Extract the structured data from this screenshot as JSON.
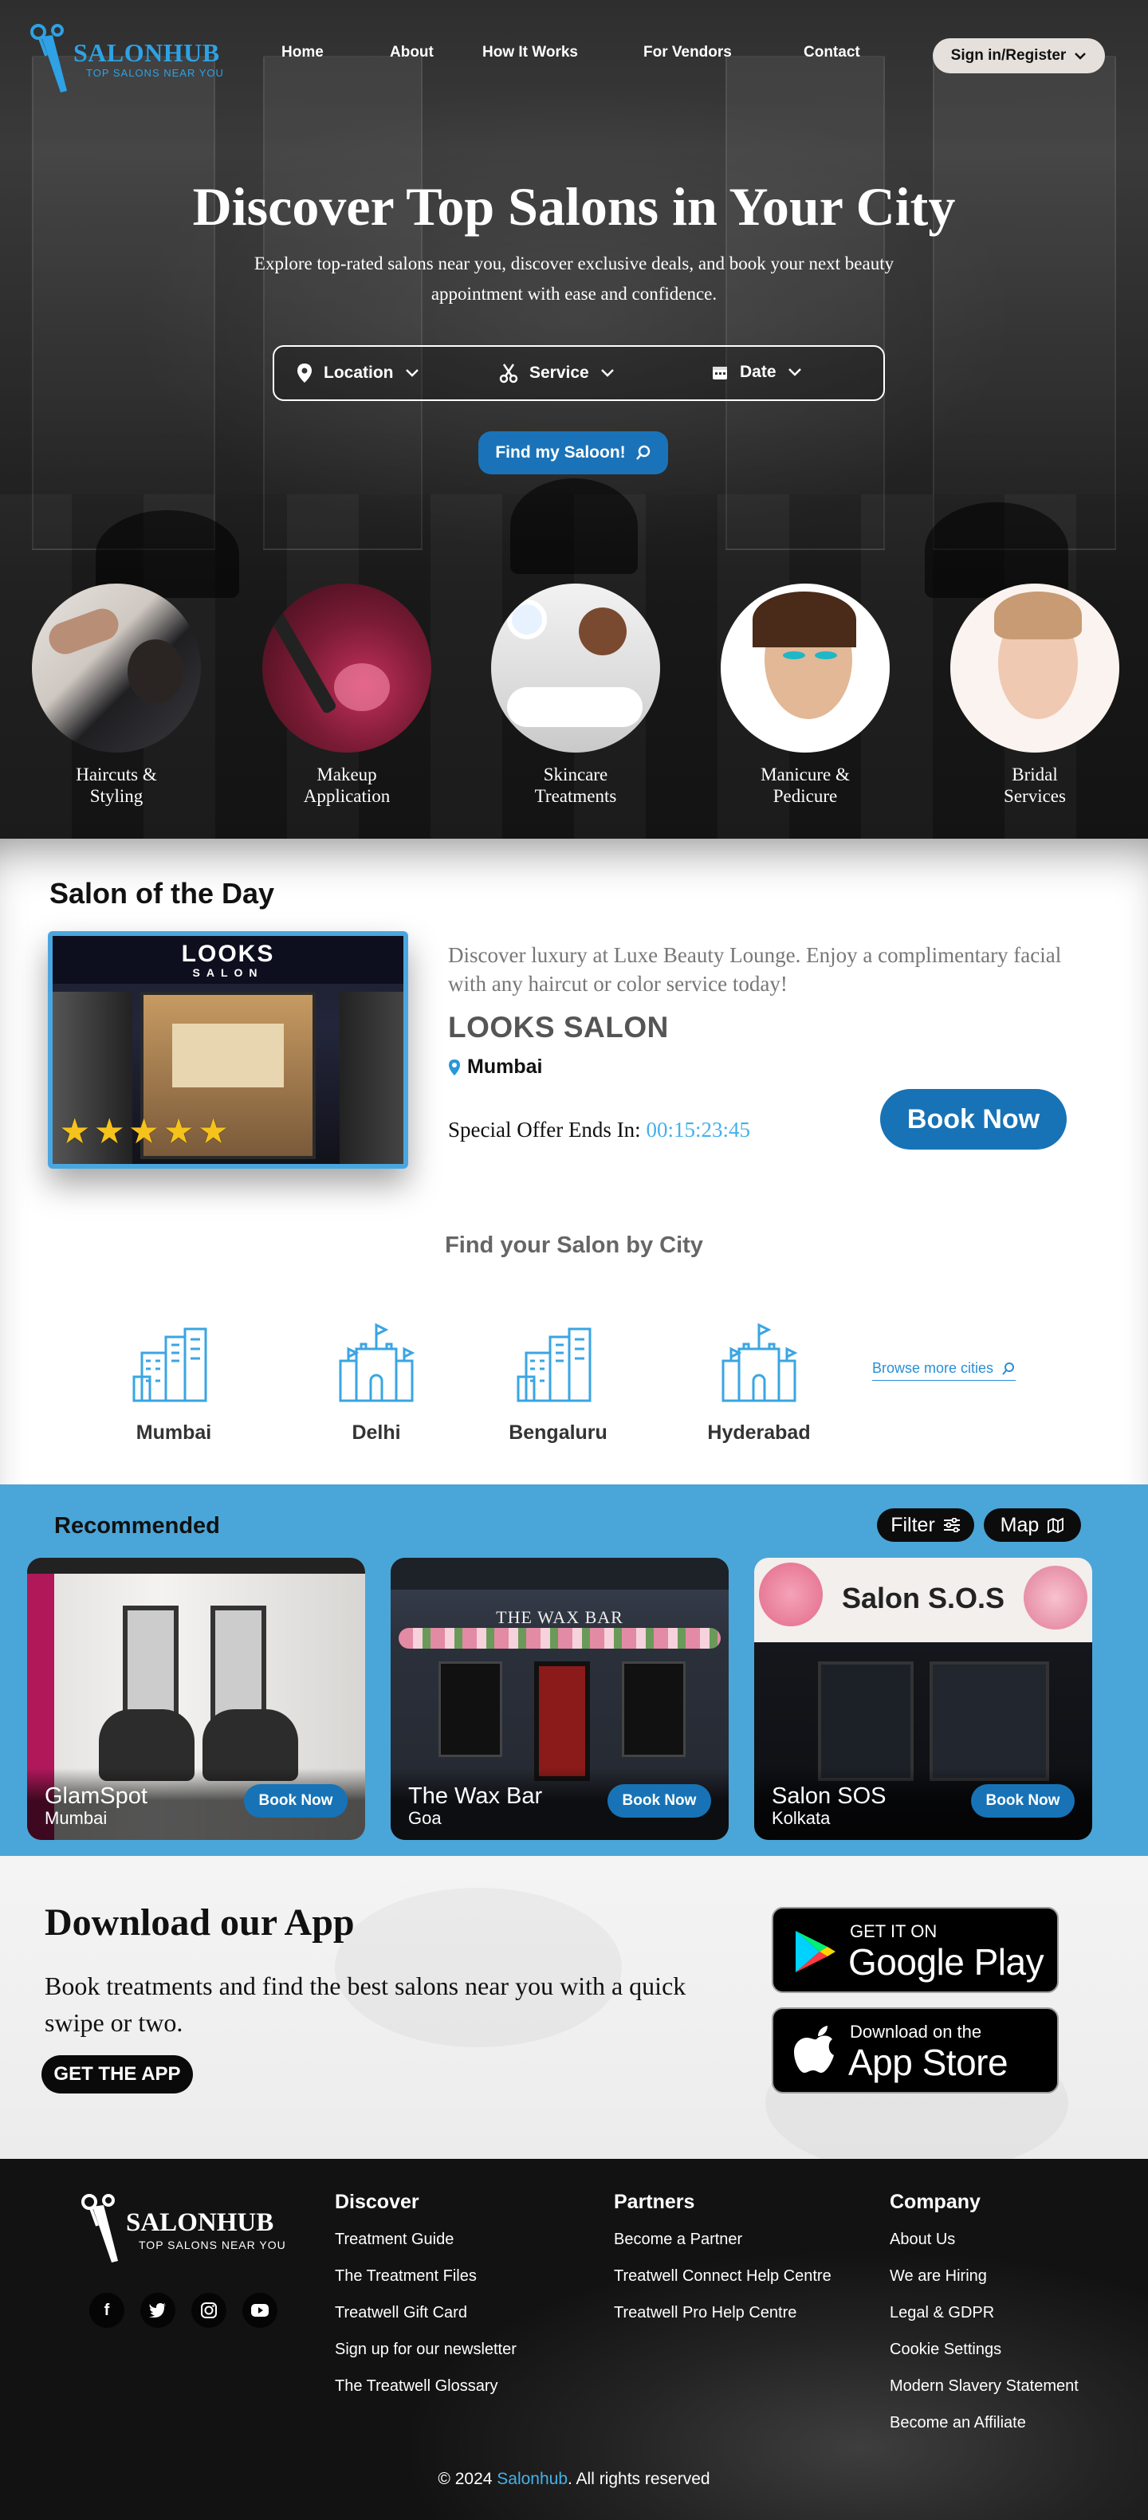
{
  "nav": {
    "brand": "SALONHUB",
    "tagline": "TOP SALONS NEAR YOU",
    "links": [
      "Home",
      "About",
      "How It Works",
      "For Vendors",
      "Contact"
    ],
    "signin_label": "Sign in/Register"
  },
  "hero": {
    "title": "Discover Top Salons in Your City",
    "subtitle": "Explore top-rated salons near you, discover exclusive deals, and book your next beauty appointment with ease and confidence.",
    "search": {
      "location": "Location",
      "service": "Service",
      "date": "Date"
    },
    "find_button": "Find my Saloon!"
  },
  "categories": [
    {
      "line1": "Haircuts &",
      "line2": "Styling"
    },
    {
      "line1": "Makeup",
      "line2": "Application"
    },
    {
      "line1": "Skincare",
      "line2": "Treatments"
    },
    {
      "line1": "Manicure &",
      "line2": "Pedicure"
    },
    {
      "line1": "Bridal",
      "line2": "Services"
    }
  ],
  "salon_of_day": {
    "heading": "Salon of the Day",
    "sign_line1": "LOOKS",
    "sign_line2": "SALON",
    "rating_stars": 5,
    "promo": "Discover luxury at Luxe Beauty Lounge. Enjoy a complimentary facial with any haircut or color service today!",
    "name": "LOOKS SALON",
    "city": "Mumbai",
    "offer_label": "Special Offer Ends In:",
    "timer": "00:15:23:45",
    "book_label": "Book Now"
  },
  "cities": {
    "heading": "Find your Salon by City",
    "items": [
      "Mumbai",
      "Delhi",
      "Bengaluru",
      "Hyderabad"
    ],
    "browse_label": "Browse more cities"
  },
  "recommended": {
    "heading": "Recommended",
    "filter_label": "Filter",
    "map_label": "Map",
    "cards": [
      {
        "name": "GlamSpot",
        "city": "Mumbai",
        "button": "Book Now"
      },
      {
        "name": "The Wax Bar",
        "city": "Goa",
        "button": "Book Now",
        "sign": "THE WAX BAR"
      },
      {
        "name": "Salon SOS",
        "city": "Kolkata",
        "button": "Book Now",
        "sign": "Salon S.O.S"
      }
    ]
  },
  "app": {
    "title": "Download our App",
    "subtitle": "Book treatments and find the best salons near you with a quick swipe or two.",
    "cta": "GET THE APP",
    "google": {
      "small": "GET IT ON",
      "big": "Google Play"
    },
    "apple": {
      "small": "Download on the",
      "big": "App Store"
    }
  },
  "footer": {
    "brand": "SALONHUB",
    "tagline": "TOP SALONS NEAR YOU",
    "social": [
      "facebook-icon",
      "twitter-icon",
      "instagram-icon",
      "youtube-icon"
    ],
    "discover": {
      "heading": "Discover",
      "links": [
        "Treatment Guide",
        "The Treatment Files",
        "Treatwell Gift Card",
        "Sign up for our newsletter",
        "The Treatwell Glossary"
      ]
    },
    "partners": {
      "heading": "Partners",
      "links": [
        "Become a Partner",
        "Treatwell Connect Help Centre",
        "Treatwell Pro Help Centre"
      ]
    },
    "company": {
      "heading": "Company",
      "links": [
        "About Us",
        "We are Hiring",
        "Legal & GDPR",
        "Cookie Settings",
        "Modern Slavery Statement",
        "Become an Affiliate"
      ]
    },
    "copyright_prefix": "© 2024 ",
    "copyright_brand": "Salonhub",
    "copyright_suffix": ". All rights reserved"
  },
  "colors": {
    "accent": "#1773b6",
    "light_accent": "#46b0ea",
    "recommended_bg": "#4aa6d8",
    "star": "#f6c21c"
  }
}
